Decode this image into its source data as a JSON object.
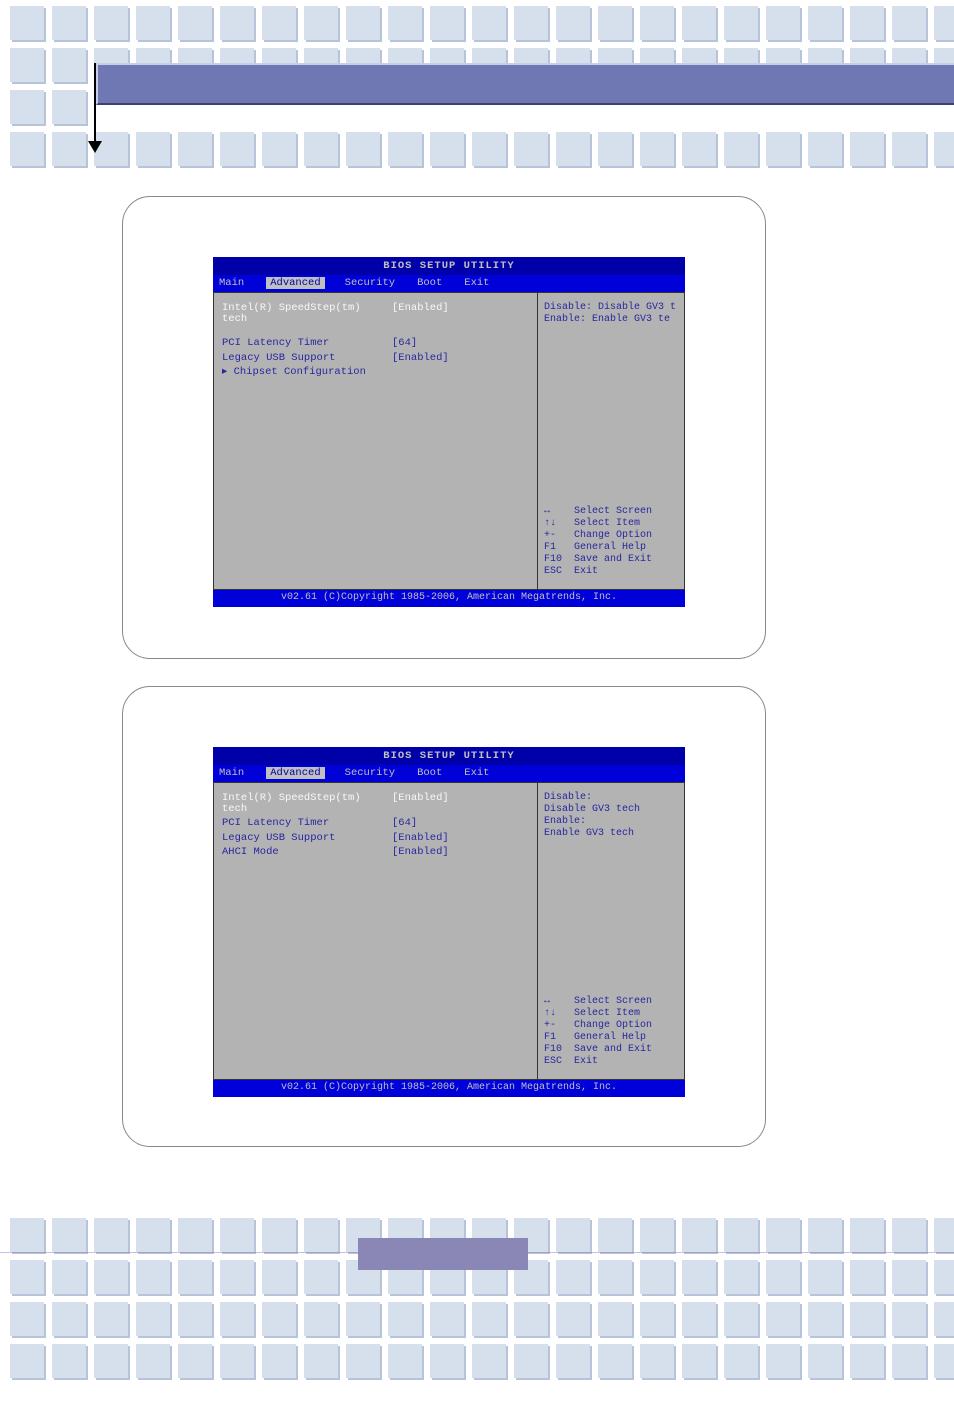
{
  "bios": {
    "title": "BIOS SETUP UTILITY",
    "tabs": {
      "main": "Main",
      "advanced": "Advanced",
      "security": "Security",
      "boot": "Boot",
      "exit": "Exit"
    },
    "footer": "v02.61 (C)Copyright 1985-2006, American Megatrends, Inc.",
    "keys": {
      "lr": {
        "k": "↔",
        "d": "Select Screen"
      },
      "ud": {
        "k": "↑↓",
        "d": "Select Item"
      },
      "pm": {
        "k": "+-",
        "d": "Change Option"
      },
      "f1": {
        "k": "F1",
        "d": "General Help"
      },
      "f10": {
        "k": "F10",
        "d": "Save and Exit"
      },
      "esc": {
        "k": "ESC",
        "d": "Exit"
      }
    }
  },
  "screen1": {
    "rows": {
      "speedstep": {
        "label": "Intel(R) SpeedStep(tm) tech",
        "value": "[Enabled]"
      },
      "pci": {
        "label": "PCI Latency Timer",
        "value": "[64]"
      },
      "usb": {
        "label": "Legacy USB Support",
        "value": "[Enabled]"
      },
      "chipset": {
        "label": "Chipset Configuration"
      }
    },
    "help": {
      "l1": "Disable: Disable GV3 t",
      "l2": "Enable:  Enable GV3 te"
    }
  },
  "screen2": {
    "rows": {
      "speedstep": {
        "label": "Intel(R) SpeedStep(tm) tech",
        "value": "[Enabled]"
      },
      "pci": {
        "label": "PCI Latency Timer",
        "value": "[64]"
      },
      "usb": {
        "label": "Legacy USB Support",
        "value": "[Enabled]"
      },
      "ahci": {
        "label": "AHCI Mode",
        "value": "[Enabled]"
      }
    },
    "help": {
      "l1": "Disable:",
      "l2": " Disable GV3 tech",
      "l3": "Enable:",
      "l4": " Enable GV3 tech"
    }
  }
}
